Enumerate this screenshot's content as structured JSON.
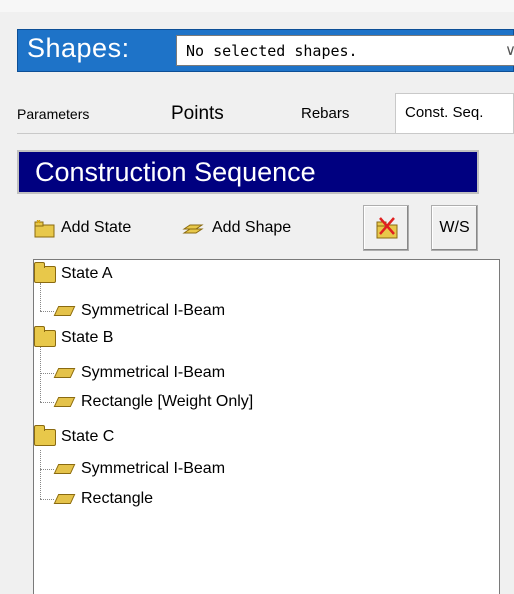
{
  "shapes_bar": {
    "label": "Shapes:",
    "selected": "No selected shapes."
  },
  "tabs": [
    "Parameters",
    "Points",
    "Rebars",
    "Const. Seq."
  ],
  "panel_title": "Construction Sequence",
  "toolbar": {
    "add_state": "Add State",
    "add_shape": "Add Shape",
    "ws": "W/S"
  },
  "tree": {
    "states": [
      {
        "label": "State A",
        "children": [
          "Symmetrical I-Beam"
        ]
      },
      {
        "label": "State B",
        "children": [
          "Symmetrical I-Beam",
          "Rectangle [Weight Only]"
        ]
      },
      {
        "label": "State C",
        "children": [
          "Symmetrical I-Beam",
          "Rectangle"
        ]
      }
    ]
  },
  "colors": {
    "shapes_bar": "#1e73c8",
    "title_bar": "#000080",
    "folder": "#e8c84a"
  }
}
